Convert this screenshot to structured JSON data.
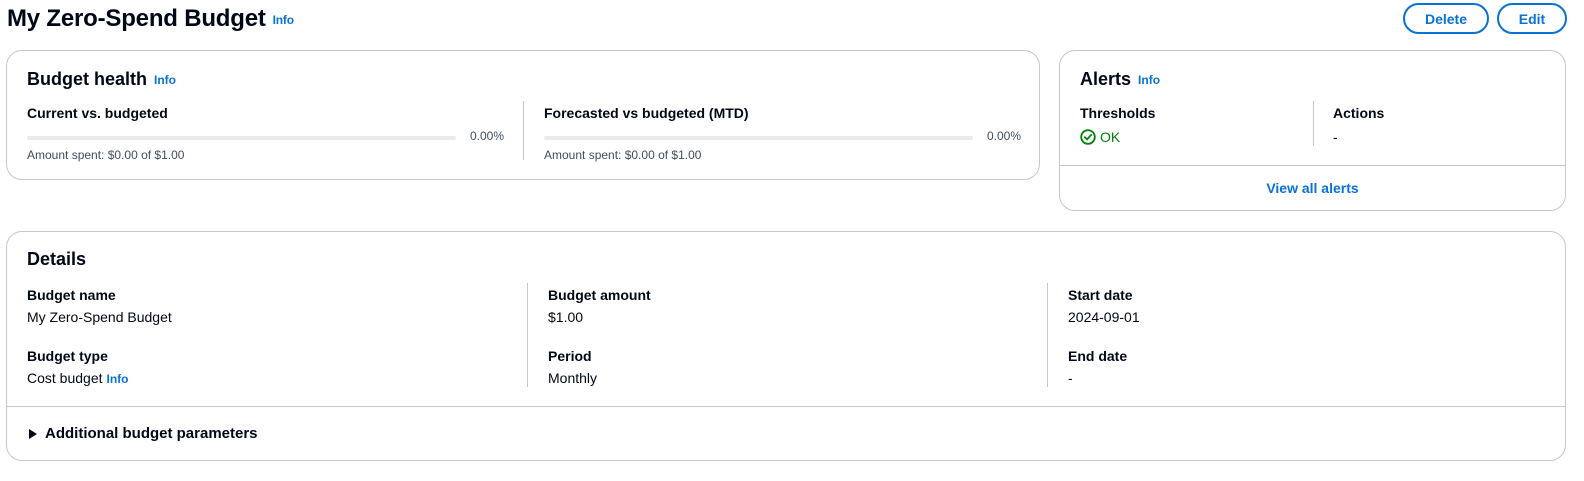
{
  "header": {
    "title": "My Zero-Spend Budget",
    "info": "Info",
    "delete_label": "Delete",
    "edit_label": "Edit"
  },
  "budget_health": {
    "title": "Budget health",
    "info": "Info",
    "current": {
      "label": "Current vs. budgeted",
      "percent_text": "0.00%",
      "progress": 0,
      "amount_text": "Amount spent: $0.00 of $1.00"
    },
    "forecast": {
      "label": "Forecasted vs budgeted (MTD)",
      "percent_text": "0.00%",
      "progress": 0,
      "amount_text": "Amount spent: $0.00 of $1.00"
    }
  },
  "alerts": {
    "title": "Alerts",
    "info": "Info",
    "thresholds_label": "Thresholds",
    "thresholds_value": "OK",
    "actions_label": "Actions",
    "actions_value": "-",
    "view_all_label": "View all alerts",
    "status_icon": "status-positive-icon"
  },
  "details": {
    "title": "Details",
    "budget_name_label": "Budget name",
    "budget_name_value": "My Zero-Spend Budget",
    "budget_type_label": "Budget type",
    "budget_type_value": "Cost budget",
    "budget_type_info": "Info",
    "budget_amount_label": "Budget amount",
    "budget_amount_value": "$1.00",
    "period_label": "Period",
    "period_value": "Monthly",
    "start_date_label": "Start date",
    "start_date_value": "2024-09-01",
    "end_date_label": "End date",
    "end_date_value": "-",
    "additional_label": "Additional budget parameters"
  },
  "colors": {
    "link": "#0972d3",
    "success": "#037f0c",
    "border": "#c6c6cd",
    "text": "#000716"
  }
}
